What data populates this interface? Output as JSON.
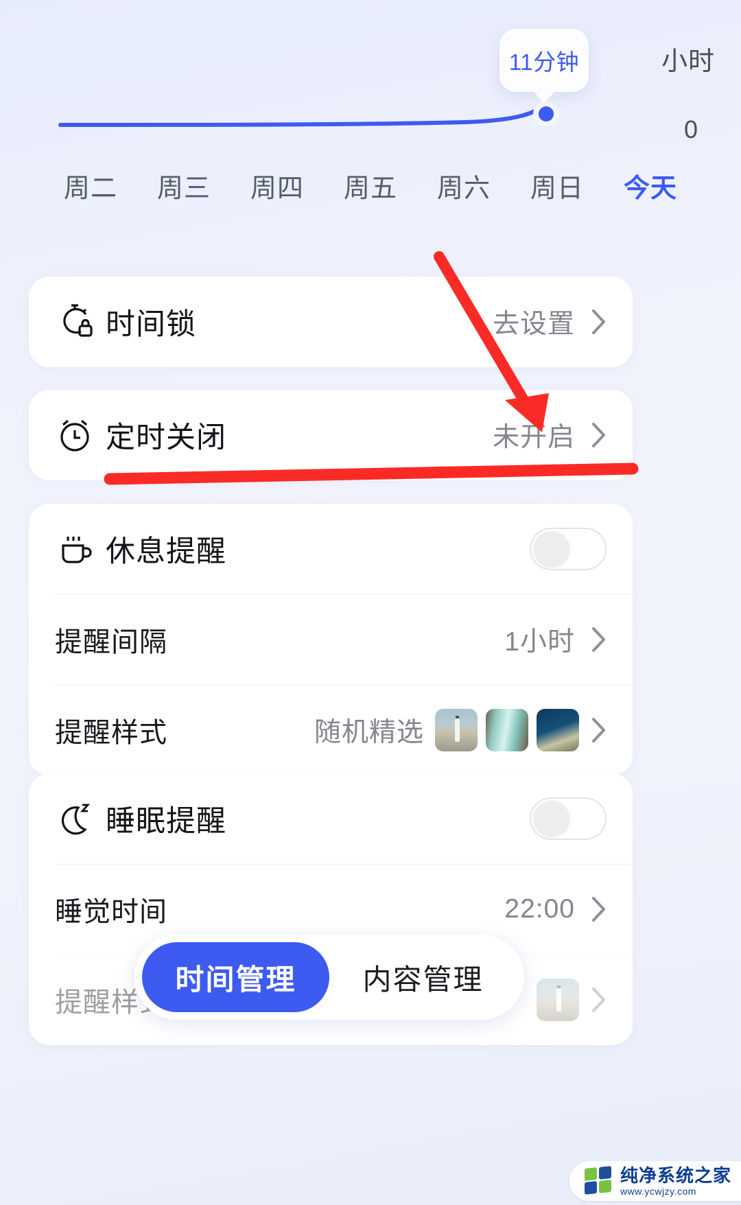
{
  "chart": {
    "tooltip_value": "11分钟",
    "y_top_label": "小时",
    "y_bottom_label": "0",
    "accent_color": "#3d5bf0"
  },
  "chart_data": {
    "type": "line",
    "title": "",
    "xlabel": "",
    "ylabel": "小时",
    "categories": [
      "周二",
      "周三",
      "周四",
      "周五",
      "周六",
      "周日",
      "今天"
    ],
    "values": [
      0.0,
      0.0,
      0.0,
      0.0,
      0.0,
      0.02,
      0.18
    ],
    "ylim": [
      0,
      1
    ],
    "annotations": [
      "11分钟"
    ],
    "grid": false,
    "legend": "none"
  },
  "days": {
    "items": [
      {
        "label": "周二",
        "active": false
      },
      {
        "label": "周三",
        "active": false
      },
      {
        "label": "周四",
        "active": false
      },
      {
        "label": "周五",
        "active": false
      },
      {
        "label": "周六",
        "active": false
      },
      {
        "label": "周日",
        "active": false
      },
      {
        "label": "今天",
        "active": true
      }
    ]
  },
  "cards": {
    "time_lock": {
      "label": "时间锁",
      "value": "去设置",
      "icon": "stopwatch-lock-icon"
    },
    "scheduled_off": {
      "label": "定时关闭",
      "value": "未开启",
      "icon": "alarm-clock-icon"
    },
    "rest_reminder": {
      "label": "休息提醒",
      "icon": "coffee-cup-icon",
      "toggle_on": false,
      "interval_label": "提醒间隔",
      "interval_value": "1小时",
      "style_label": "提醒样式",
      "style_value": "随机精选",
      "thumbnails": [
        "lighthouse-thumb",
        "waterfall-thumb",
        "coastline-thumb"
      ]
    },
    "sleep_reminder": {
      "label": "睡眠提醒",
      "icon": "moon-z-icon",
      "toggle_on": false,
      "bedtime_label": "睡觉时间",
      "bedtime_value": "22:00",
      "style_label": "提醒样式"
    }
  },
  "tabbar": {
    "tabs": [
      {
        "label": "时间管理",
        "active": true
      },
      {
        "label": "内容管理",
        "active": false
      }
    ]
  },
  "watermark": {
    "name": "纯净系统之家",
    "url": "www.ycwjzy.com"
  }
}
